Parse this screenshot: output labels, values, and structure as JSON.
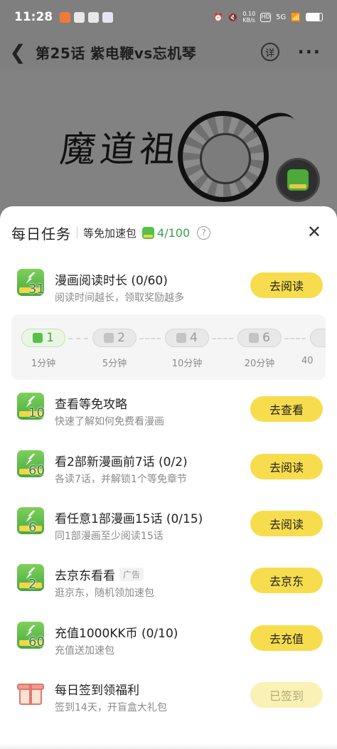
{
  "status_bar": {
    "time": "11:28",
    "network_speed": "0.10\nKB/s",
    "hd": "HD",
    "signal": "5G",
    "battery_icon": "battery-icon"
  },
  "nav": {
    "title": "第25话 紫电鞭vs忘机琴",
    "detail_label": "详",
    "more_label": "···"
  },
  "comic": {
    "calligraphy": "魔道祖師"
  },
  "sheet": {
    "title": "每日任务",
    "subtitle": "等免加速包",
    "pack_count": "4/100",
    "help": "?",
    "close": "✕"
  },
  "tasks": [
    {
      "name": "漫画阅读时长 (0/60)",
      "desc": "阅读时间越长，领取奖励越多",
      "reward": "31",
      "button": "去阅读",
      "icon": "boost-pack-icon"
    },
    {
      "name": "查看等免攻略",
      "desc": "快速了解如何免费看漫画",
      "reward": "10",
      "button": "去查看",
      "icon": "boost-pack-icon"
    },
    {
      "name": "看2部新漫画前7话 (0/2)",
      "desc": "各读7话，并解锁1个等免章节",
      "reward": "60",
      "button": "去阅读",
      "icon": "boost-pack-icon"
    },
    {
      "name": "看任意1部漫画15话 (0/15)",
      "desc": "同1部漫画至少阅读15话",
      "reward": "6",
      "button": "去阅读",
      "icon": "boost-pack-icon"
    },
    {
      "name": "去京东看看",
      "tag": "广告",
      "desc": "逛京东，随机领加速包",
      "reward": "2",
      "button": "去京东",
      "icon": "boost-pack-icon"
    },
    {
      "name": "充值1000KK币 (0/10)",
      "desc": "充值送加速包",
      "reward": "60",
      "button": "去充值",
      "icon": "boost-pack-icon"
    },
    {
      "name": "每日签到领福利",
      "desc": "签到14天，开盲盒大礼包",
      "reward": "",
      "button": "已签到",
      "icon": "gift-icon"
    }
  ],
  "reading_stages": [
    {
      "count": "1",
      "label": "1分钟",
      "active": true
    },
    {
      "count": "2",
      "label": "5分钟",
      "active": false
    },
    {
      "count": "4",
      "label": "10分钟",
      "active": false
    },
    {
      "count": "6",
      "label": "20分钟",
      "active": false
    },
    {
      "count": "",
      "label": "40",
      "active": false
    }
  ]
}
